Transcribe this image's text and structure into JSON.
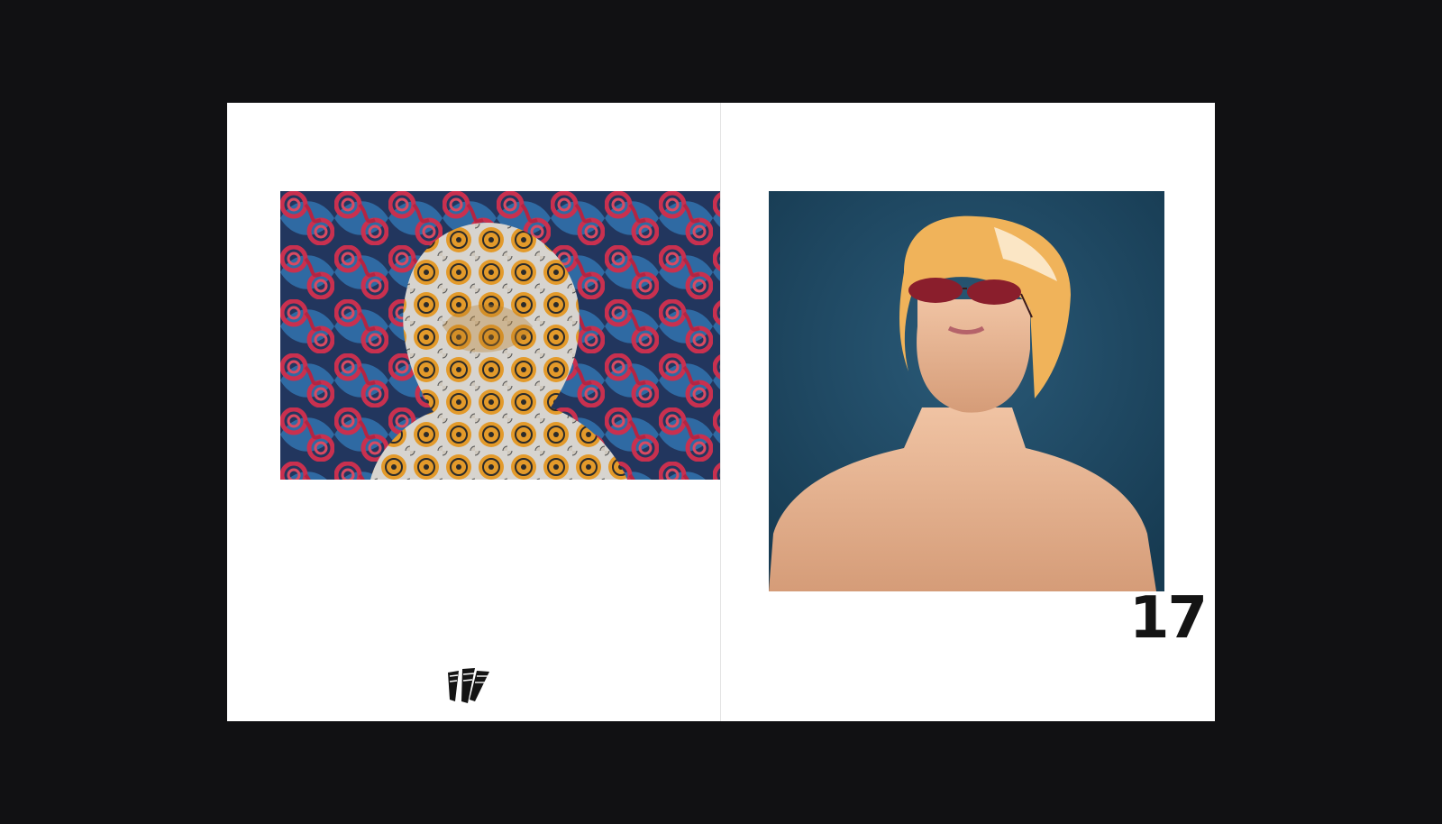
{
  "viewer": {
    "background": "#111113",
    "page_background": "#ffffff"
  },
  "left_page": {
    "photo": {
      "icon": "photo-patterned-fabric-figure",
      "colors": [
        "#c9304f",
        "#2b5d92",
        "#e39a2a",
        "#d7d4cf"
      ]
    },
    "logo": {
      "icon": "publisher-stripes-logo"
    }
  },
  "right_page": {
    "photo": {
      "icon": "photo-portrait-towel-sunglasses",
      "colors": [
        "#1c4560",
        "#f0b35a",
        "#8a1e2c",
        "#e3b08c"
      ]
    },
    "page_number": "17"
  }
}
